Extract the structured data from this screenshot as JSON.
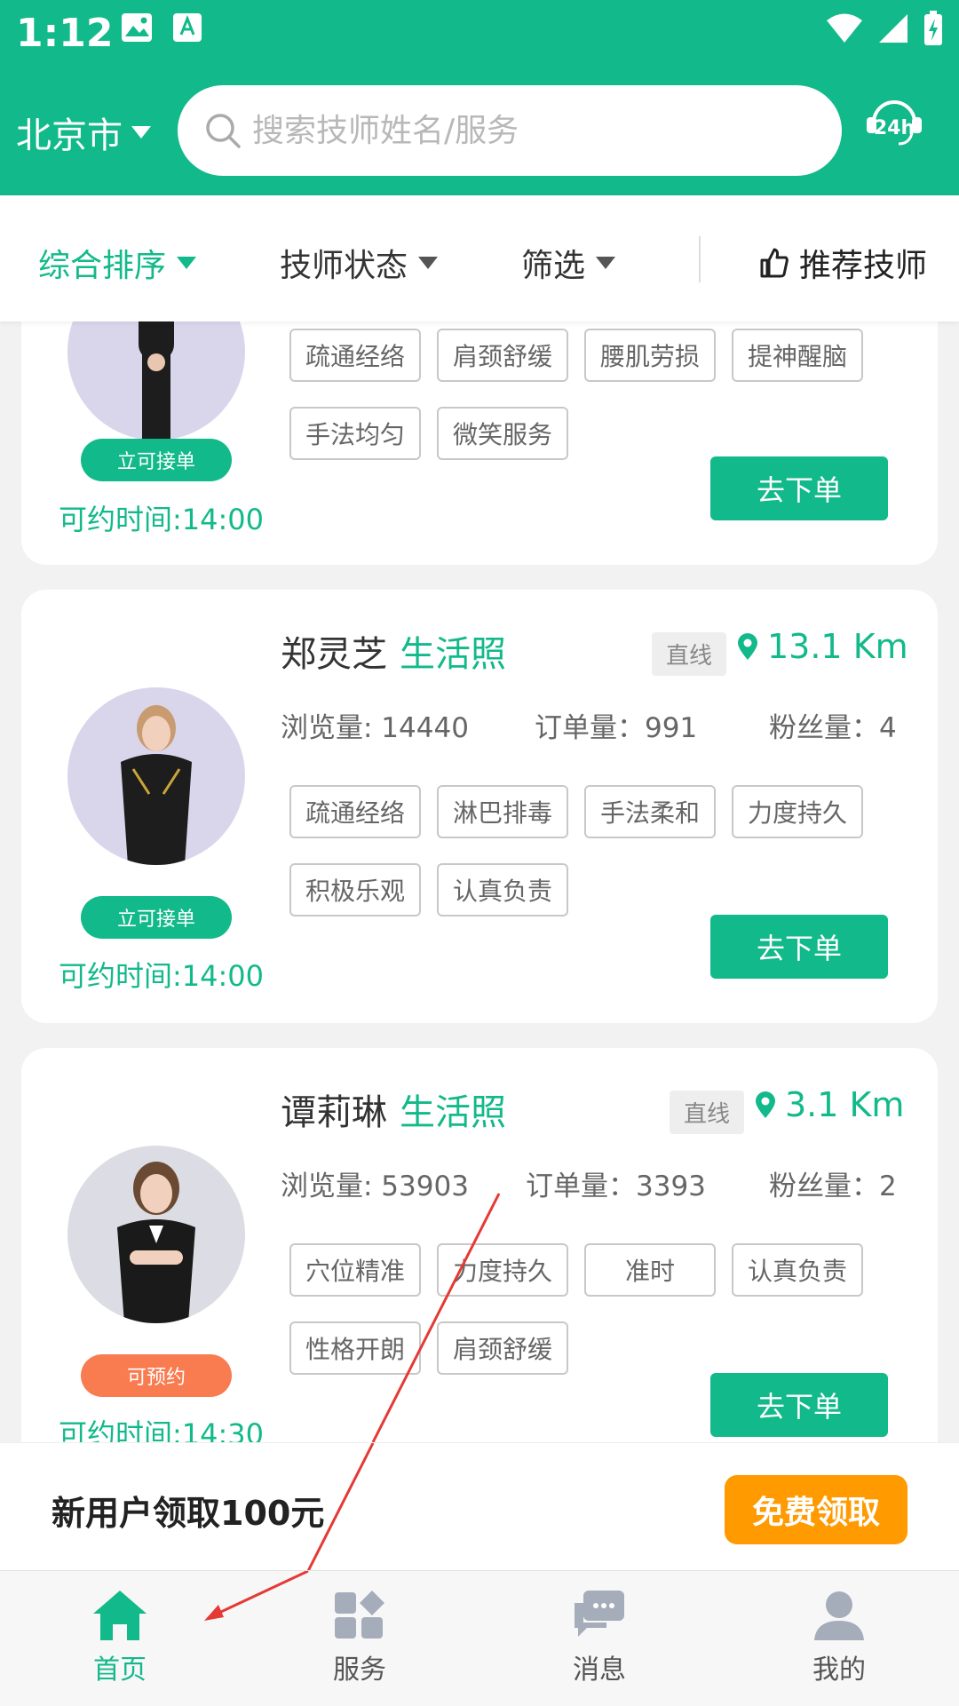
{
  "status_bar": {
    "time": "1:12"
  },
  "header": {
    "city": "北京市",
    "search_placeholder": "搜索技师姓名/服务"
  },
  "filters": {
    "sort": "综合排序",
    "status": "技师状态",
    "filter": "筛选",
    "recommend": "推荐技师"
  },
  "common": {
    "straight": "直线",
    "photo_link": "生活照",
    "order_button": "去下单"
  },
  "cards": [
    {
      "badge": "立可接单",
      "available_time": "可约时间:14:00",
      "tags": [
        "疏通经络",
        "肩颈舒缓",
        "腰肌劳损",
        "提神醒脑",
        "手法均匀",
        "微笑服务"
      ]
    },
    {
      "name": "郑灵芝",
      "distance": "13.1 Km",
      "views": "浏览量: 14440",
      "orders": "订单量：991",
      "fans": "粉丝量：4",
      "badge": "立可接单",
      "available_time": "可约时间:14:00",
      "tags": [
        "疏通经络",
        "淋巴排毒",
        "手法柔和",
        "力度持久",
        "积极乐观",
        "认真负责"
      ]
    },
    {
      "name": "谭莉琳",
      "distance": "3.1 Km",
      "views": "浏览量: 53903",
      "orders": "订单量：3393",
      "fans": "粉丝量：2",
      "badge": "可预约",
      "available_time": "可约时间:14:30",
      "tags": [
        "穴位精准",
        "力度持久",
        "准时",
        "认真负责",
        "性格开朗",
        "肩颈舒缓"
      ]
    }
  ],
  "promo": {
    "text": "新用户领取100元",
    "button": "免费领取"
  },
  "tabbar": {
    "home": "首页",
    "service": "服务",
    "message": "消息",
    "mine": "我的"
  },
  "colors": {
    "primary": "#12b98a",
    "orange_badge": "#f97b50",
    "promo_button": "#ff9a00"
  }
}
